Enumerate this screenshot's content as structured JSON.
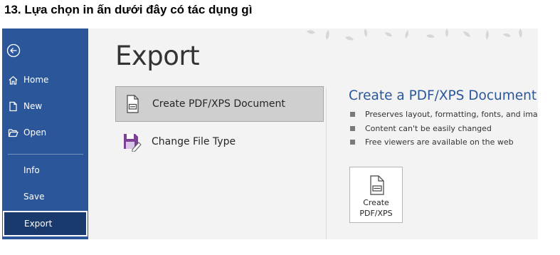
{
  "question": "13. Lựa chọn in ấn dưới đây có tác dụng gì",
  "backstage": {
    "nav": {
      "back_icon": "back-arrow-circle-icon",
      "items": [
        {
          "label": "Home",
          "icon": "home-icon"
        },
        {
          "label": "New",
          "icon": "new-document-icon"
        },
        {
          "label": "Open",
          "icon": "open-folder-icon"
        },
        {
          "label": "Info"
        },
        {
          "label": "Save"
        },
        {
          "label": "Export",
          "active": true
        }
      ]
    },
    "page_title": "Export",
    "options": [
      {
        "label": "Create PDF/XPS Document",
        "icon": "pdf-document-icon",
        "selected": true
      },
      {
        "label": "Change File Type",
        "icon": "save-as-icon",
        "selected": false
      }
    ],
    "detail": {
      "title": "Create a PDF/XPS Document",
      "bullets": [
        "Preserves layout, formatting, fonts, and images",
        "Content can't be easily changed",
        "Free viewers are available on the web"
      ],
      "button": {
        "line1": "Create",
        "line2": "PDF/XPS",
        "icon": "pdf-document-icon"
      }
    }
  },
  "colors": {
    "sidebar": "#2b579a",
    "sidebar_active": "#1a3a6d",
    "accent_title": "#2b579a",
    "background": "#f3f3f3",
    "selected_option": "#cfcfcf",
    "save_as_icon": "#7e3f98"
  }
}
